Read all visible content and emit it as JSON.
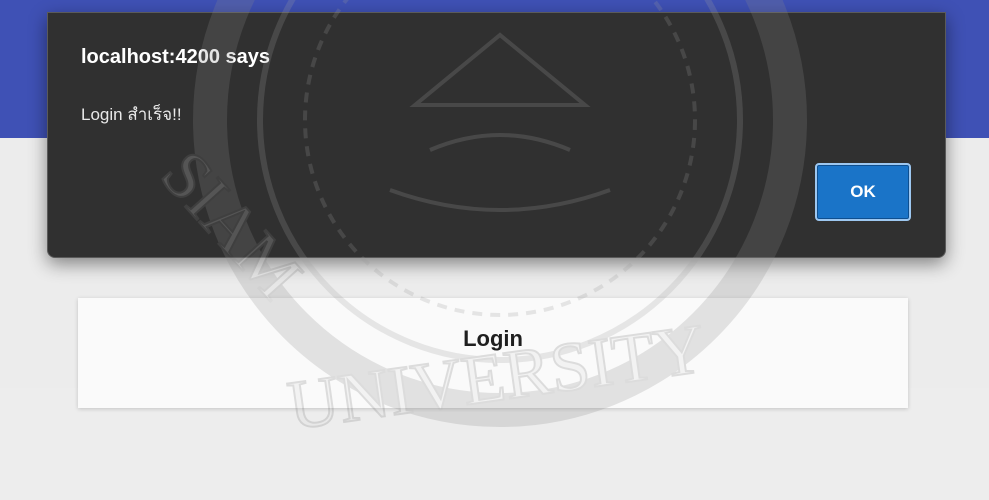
{
  "dialog": {
    "title": "localhost:4200 says",
    "message": "Login สำเร็จ!!",
    "ok_label": "OK"
  },
  "page": {
    "login_title": "Login"
  },
  "watermark": {
    "bottom_text": "UNIVERSITY",
    "left_text": "SIAM"
  }
}
